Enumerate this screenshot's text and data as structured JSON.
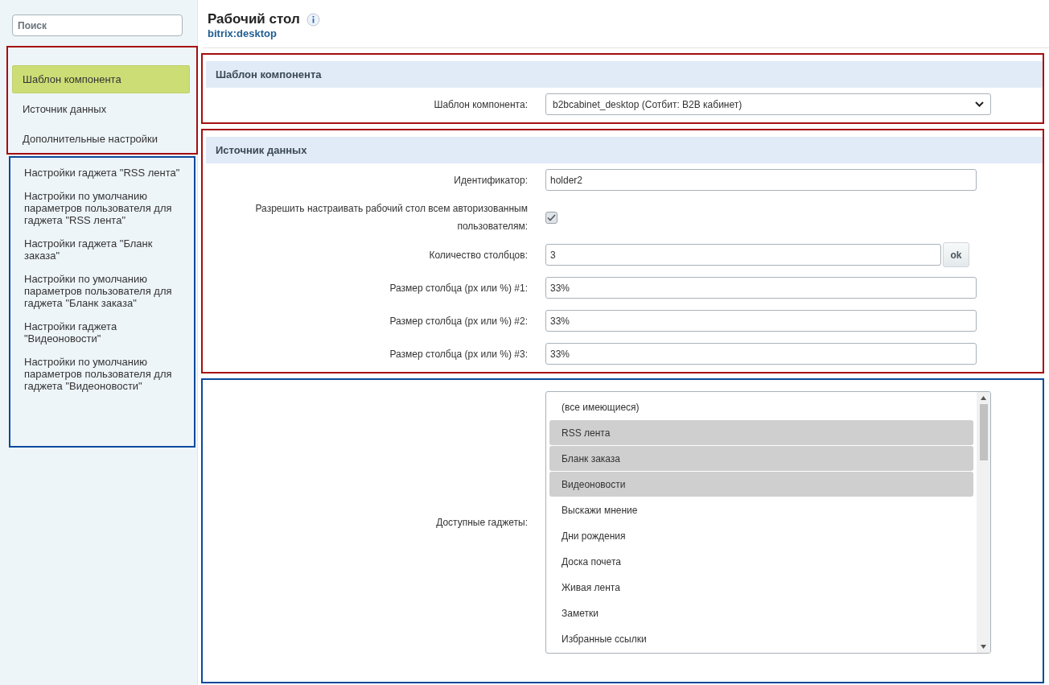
{
  "sidebar": {
    "search": {
      "placeholder": "Поиск"
    },
    "groups": [
      {
        "color": "#a50e0e",
        "items": [
          {
            "label": "Шаблон компонента",
            "selected": true
          },
          {
            "label": "Источник данных",
            "selected": false
          },
          {
            "label": "Дополнительные настройки",
            "selected": false
          }
        ]
      },
      {
        "color": "#0a4a9b",
        "items": [
          {
            "label": "Настройки гаджета \"RSS лента\"",
            "selected": false
          },
          {
            "label": "Настройки по умолчанию параметров пользователя для гаджета \"RSS лента\"",
            "selected": false
          },
          {
            "label": "Настройки гаджета \"Бланк заказа\"",
            "selected": false
          },
          {
            "label": "Настройки по умолчанию параметров пользователя для гаджета \"Бланк заказа\"",
            "selected": false
          },
          {
            "label": "Настройки гаджета \"Видеоновости\"",
            "selected": false
          },
          {
            "label": "Настройки по умолчанию параметров пользователя для гаджета \"Видеоновости\"",
            "selected": false
          }
        ]
      }
    ]
  },
  "header": {
    "title": "Рабочий стол",
    "subtitle": "bitrix:desktop"
  },
  "groups": [
    {
      "color": "#a50e0e",
      "heading": "Шаблон компонента",
      "rows": [
        {
          "kind": "select",
          "label": "Шаблон компонента:",
          "value": "b2bcabinet_desktop (Сотбит: B2B кабинет)"
        }
      ]
    },
    {
      "color": "#a50e0e",
      "heading": "Источник данных",
      "rows": [
        {
          "kind": "text",
          "label": "Идентификатор:",
          "value": "holder2"
        },
        {
          "kind": "checkbox",
          "label": "Разрешить настраивать рабочий стол всем авторизованным пользователям:",
          "checked": true
        },
        {
          "kind": "text_button",
          "label": "Количество столбцов:",
          "value": "3",
          "button": "ok"
        },
        {
          "kind": "text",
          "label": "Размер столбца (px или %) #1:",
          "value": "33%"
        },
        {
          "kind": "text",
          "label": "Размер столбца (px или %) #2:",
          "value": "33%"
        },
        {
          "kind": "text",
          "label": "Размер столбца (px или %) #3:",
          "value": "33%"
        }
      ]
    },
    {
      "color": "#0a4a9b",
      "rows": [
        {
          "kind": "listbox",
          "label": "Доступные гаджеты:",
          "options": [
            {
              "label": "(все имеющиеся)",
              "selected": false
            },
            {
              "label": "RSS лента",
              "selected": true
            },
            {
              "label": "Бланк заказа",
              "selected": true
            },
            {
              "label": "Видеоновости",
              "selected": true
            },
            {
              "label": "Выскажи мнение",
              "selected": false
            },
            {
              "label": "Дни рождения",
              "selected": false
            },
            {
              "label": "Доска почета",
              "selected": false
            },
            {
              "label": "Живая лента",
              "selected": false
            },
            {
              "label": "Заметки",
              "selected": false
            },
            {
              "label": "Избранные ссылки",
              "selected": false
            }
          ]
        }
      ]
    }
  ]
}
